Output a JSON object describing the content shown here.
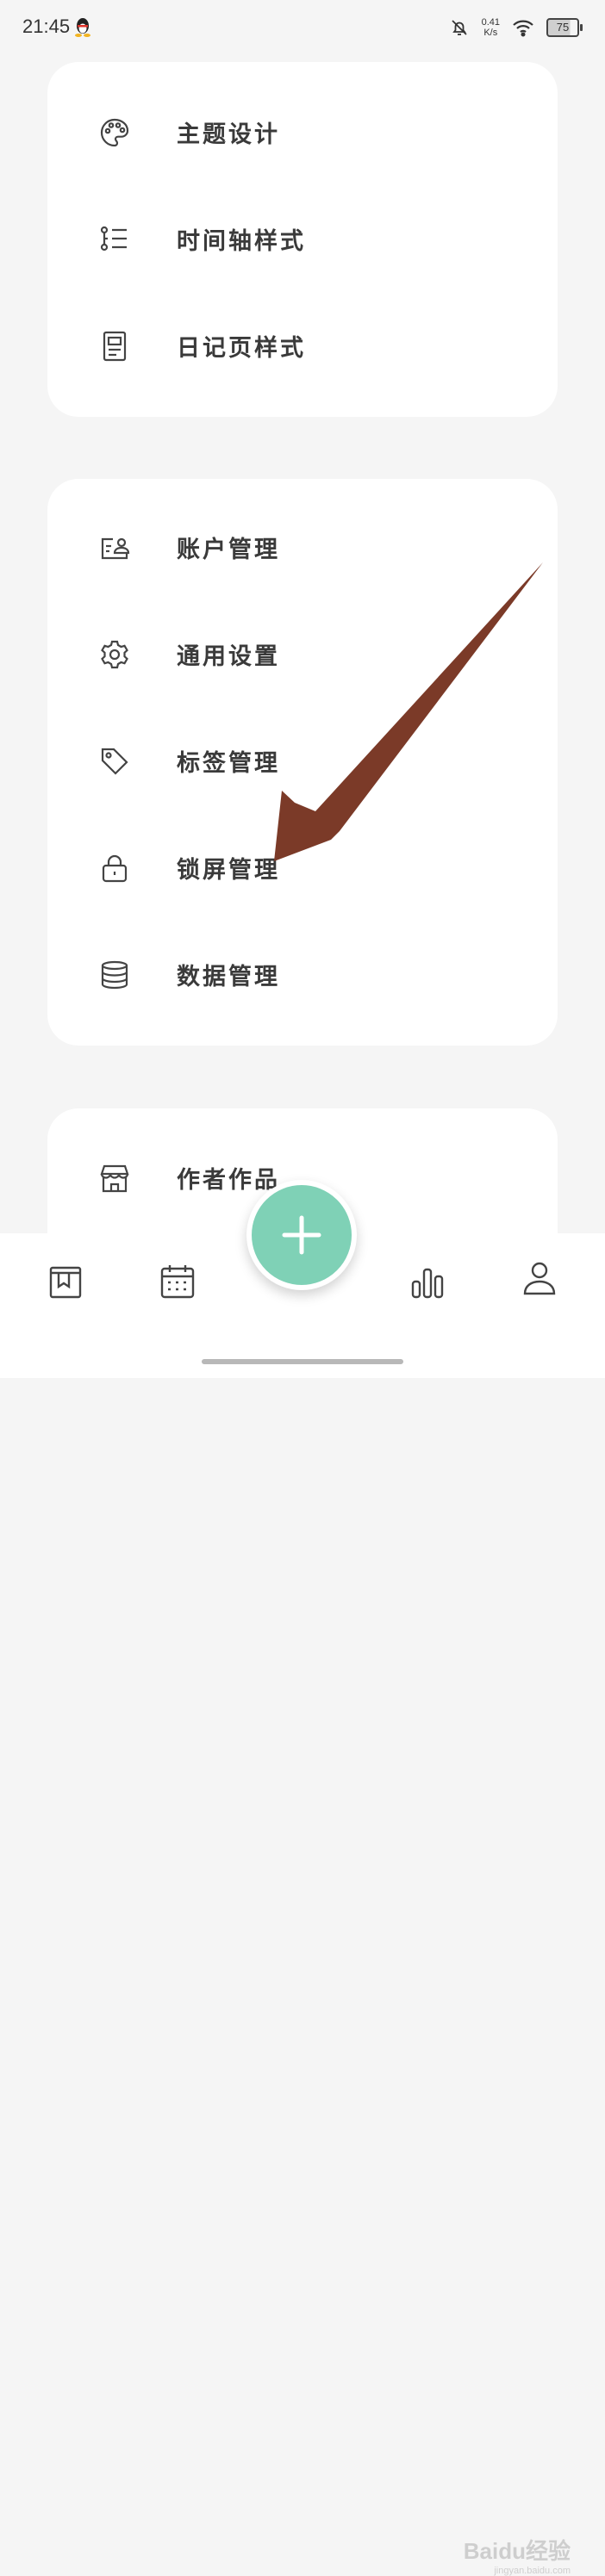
{
  "status_bar": {
    "time": "21:45",
    "net_speed_value": "0.41",
    "net_speed_unit": "K/s",
    "battery": "75",
    "icons": [
      "qq-icon",
      "bell-off-icon",
      "wifi-icon",
      "battery-icon"
    ]
  },
  "sections": {
    "appearance": [
      {
        "label": "主题设计",
        "icon": "palette-icon"
      },
      {
        "label": "时间轴样式",
        "icon": "timeline-list-icon"
      },
      {
        "label": "日记页样式",
        "icon": "document-icon"
      }
    ],
    "management": [
      {
        "label": "账户管理",
        "icon": "account-card-icon"
      },
      {
        "label": "通用设置",
        "icon": "gear-icon"
      },
      {
        "label": "标签管理",
        "icon": "tag-icon"
      },
      {
        "label": "锁屏管理",
        "icon": "lock-icon"
      },
      {
        "label": "数据管理",
        "icon": "database-icon"
      }
    ],
    "more": [
      {
        "label": "作者作品",
        "icon": "store-icon"
      }
    ]
  },
  "bottom_nav": {
    "items": [
      "diary-book-icon",
      "calendar-icon",
      "add-icon",
      "bar-chart-icon",
      "profile-icon"
    ]
  },
  "watermark": {
    "text": "Baidu经验",
    "sub": "jingyan.baidu.com"
  },
  "colors": {
    "fab": "#7fd1b6",
    "arrow": "#7b3a28",
    "card": "#ffffff",
    "background": "#f5f5f5"
  }
}
